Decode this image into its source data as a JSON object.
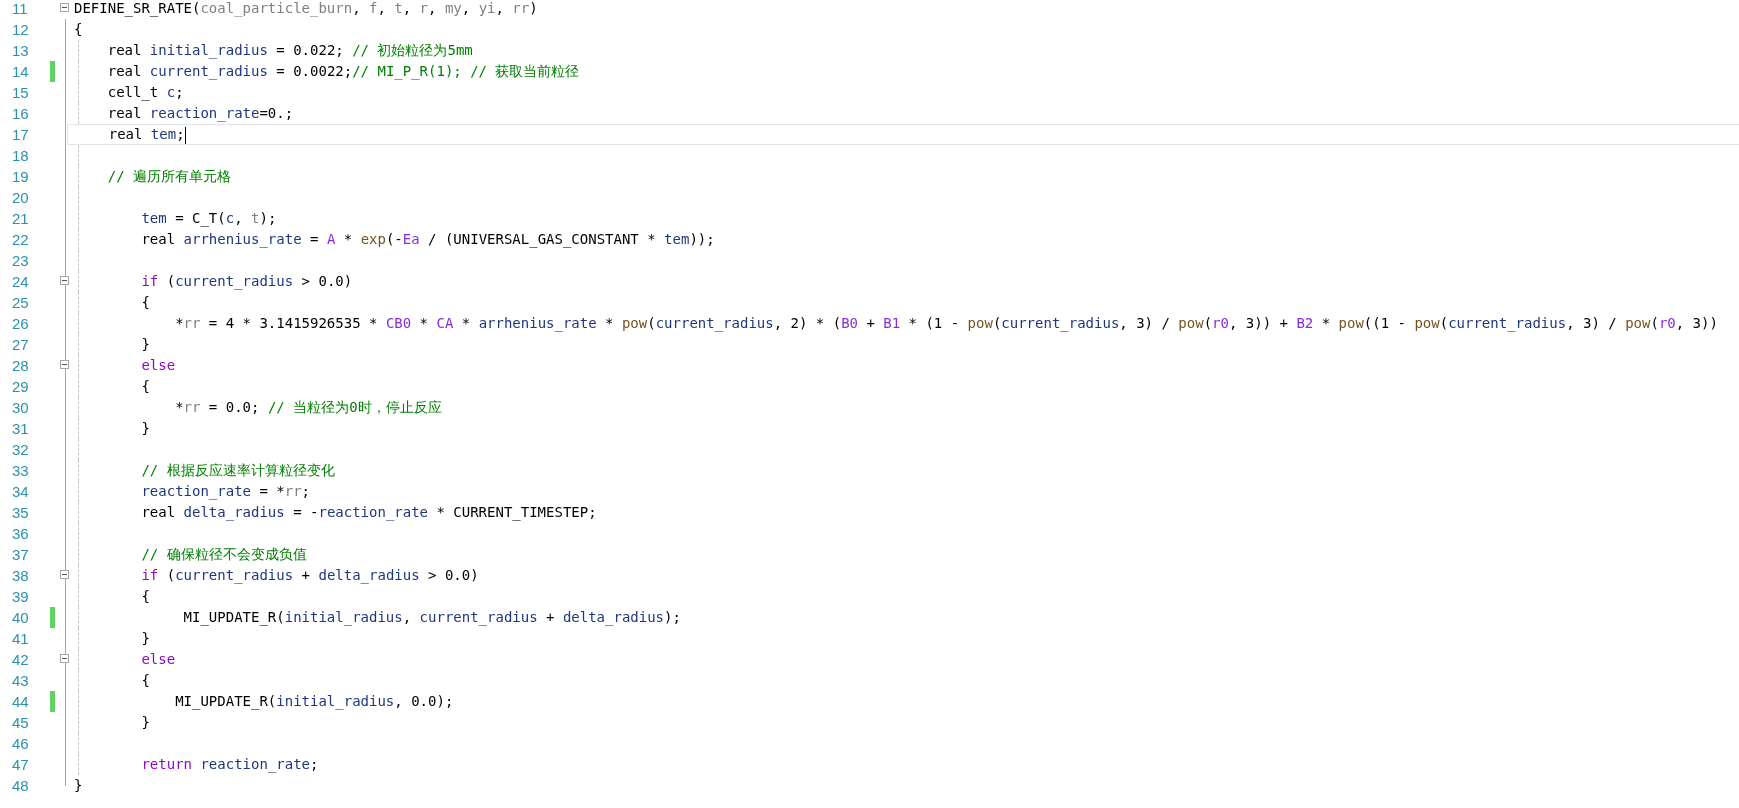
{
  "lines": [
    {
      "number": "11",
      "modified": false,
      "current": false,
      "fold": {
        "expanded": true
      },
      "tokens": [
        {
          "kind": "plain",
          "text": "DEFINE_SR_RATE("
        },
        {
          "kind": "param",
          "text": "coal_particle_burn"
        },
        {
          "kind": "plain",
          "text": ", "
        },
        {
          "kind": "param",
          "text": "f"
        },
        {
          "kind": "plain",
          "text": ", "
        },
        {
          "kind": "param",
          "text": "t"
        },
        {
          "kind": "plain",
          "text": ", "
        },
        {
          "kind": "param",
          "text": "r"
        },
        {
          "kind": "plain",
          "text": ", "
        },
        {
          "kind": "param",
          "text": "my"
        },
        {
          "kind": "plain",
          "text": ", "
        },
        {
          "kind": "param",
          "text": "yi"
        },
        {
          "kind": "plain",
          "text": ", "
        },
        {
          "kind": "param",
          "text": "rr"
        },
        {
          "kind": "plain",
          "text": ")"
        }
      ]
    },
    {
      "number": "12",
      "modified": false,
      "current": false,
      "tokens": [
        {
          "kind": "plain",
          "text": "{"
        }
      ]
    },
    {
      "number": "13",
      "modified": false,
      "current": false,
      "tokens": [
        {
          "kind": "plain",
          "text": "    real "
        },
        {
          "kind": "ident",
          "text": "initial_radius"
        },
        {
          "kind": "plain",
          "text": " = 0.022; "
        },
        {
          "kind": "comment",
          "text": "// 初始粒径为5mm"
        }
      ]
    },
    {
      "number": "14",
      "modified": true,
      "current": false,
      "tokens": [
        {
          "kind": "plain",
          "text": "    real "
        },
        {
          "kind": "ident",
          "text": "current_radius"
        },
        {
          "kind": "plain",
          "text": " = 0.0022;"
        },
        {
          "kind": "comment",
          "text": "// MI_P_R(1); // 获取当前粒径"
        }
      ]
    },
    {
      "number": "15",
      "modified": false,
      "current": false,
      "tokens": [
        {
          "kind": "plain",
          "text": "    cell_t "
        },
        {
          "kind": "ident",
          "text": "c"
        },
        {
          "kind": "plain",
          "text": ";"
        }
      ]
    },
    {
      "number": "16",
      "modified": false,
      "current": false,
      "tokens": [
        {
          "kind": "plain",
          "text": "    real "
        },
        {
          "kind": "ident",
          "text": "reaction_rate"
        },
        {
          "kind": "plain",
          "text": "=0.;"
        }
      ]
    },
    {
      "number": "17",
      "modified": false,
      "current": true,
      "tokens": [
        {
          "kind": "plain",
          "text": "    real "
        },
        {
          "kind": "ident",
          "text": "tem"
        },
        {
          "kind": "plain",
          "text": ";"
        }
      ]
    },
    {
      "number": "18",
      "modified": false,
      "current": false
    },
    {
      "number": "19",
      "modified": false,
      "current": false,
      "tokens": [
        {
          "kind": "comment",
          "text": "    // 遍历所有单元格"
        }
      ]
    },
    {
      "number": "20",
      "modified": false,
      "current": false
    },
    {
      "number": "21",
      "modified": false,
      "current": false,
      "tokens": [
        {
          "kind": "ident",
          "text": "        tem"
        },
        {
          "kind": "plain",
          "text": " = C_T("
        },
        {
          "kind": "ident",
          "text": "c"
        },
        {
          "kind": "plain",
          "text": ", "
        },
        {
          "kind": "param",
          "text": "t"
        },
        {
          "kind": "plain",
          "text": ");"
        }
      ]
    },
    {
      "number": "22",
      "modified": false,
      "current": false,
      "tokens": [
        {
          "kind": "plain",
          "text": "        real "
        },
        {
          "kind": "ident",
          "text": "arrhenius_rate"
        },
        {
          "kind": "plain",
          "text": " = "
        },
        {
          "kind": "macro",
          "text": "A"
        },
        {
          "kind": "plain",
          "text": " * "
        },
        {
          "kind": "func",
          "text": "exp"
        },
        {
          "kind": "plain",
          "text": "(-"
        },
        {
          "kind": "macro",
          "text": "Ea"
        },
        {
          "kind": "plain",
          "text": " / (UNIVERSAL_GAS_CONSTANT * "
        },
        {
          "kind": "ident",
          "text": "tem"
        },
        {
          "kind": "plain",
          "text": "));"
        }
      ]
    },
    {
      "number": "23",
      "modified": false,
      "current": false
    },
    {
      "number": "24",
      "modified": false,
      "current": false,
      "fold": {
        "expanded": true
      },
      "tokens": [
        {
          "kind": "keyword",
          "text": "        if"
        },
        {
          "kind": "plain",
          "text": " ("
        },
        {
          "kind": "ident",
          "text": "current_radius"
        },
        {
          "kind": "plain",
          "text": " > 0.0)"
        }
      ]
    },
    {
      "number": "25",
      "modified": false,
      "current": false,
      "tokens": [
        {
          "kind": "plain",
          "text": "        {"
        }
      ]
    },
    {
      "number": "26",
      "modified": false,
      "current": false,
      "tokens": [
        {
          "kind": "plain",
          "text": "            *"
        },
        {
          "kind": "param",
          "text": "rr"
        },
        {
          "kind": "plain",
          "text": " = 4 * 3.1415926535 * "
        },
        {
          "kind": "macro",
          "text": "CB0"
        },
        {
          "kind": "plain",
          "text": " * "
        },
        {
          "kind": "macro",
          "text": "CA"
        },
        {
          "kind": "plain",
          "text": " * "
        },
        {
          "kind": "ident",
          "text": "arrhenius_rate"
        },
        {
          "kind": "plain",
          "text": " * "
        },
        {
          "kind": "func",
          "text": "pow"
        },
        {
          "kind": "plain",
          "text": "("
        },
        {
          "kind": "ident",
          "text": "current_radius"
        },
        {
          "kind": "plain",
          "text": ", 2) * ("
        },
        {
          "kind": "macro",
          "text": "B0"
        },
        {
          "kind": "plain",
          "text": " + "
        },
        {
          "kind": "macro",
          "text": "B1"
        },
        {
          "kind": "plain",
          "text": " * (1 - "
        },
        {
          "kind": "func",
          "text": "pow"
        },
        {
          "kind": "plain",
          "text": "("
        },
        {
          "kind": "ident",
          "text": "current_radius"
        },
        {
          "kind": "plain",
          "text": ", 3) / "
        },
        {
          "kind": "func",
          "text": "pow"
        },
        {
          "kind": "plain",
          "text": "("
        },
        {
          "kind": "macro",
          "text": "r0"
        },
        {
          "kind": "plain",
          "text": ", 3)) + "
        },
        {
          "kind": "macro",
          "text": "B2"
        },
        {
          "kind": "plain",
          "text": " * "
        },
        {
          "kind": "func",
          "text": "pow"
        },
        {
          "kind": "plain",
          "text": "((1 - "
        },
        {
          "kind": "func",
          "text": "pow"
        },
        {
          "kind": "plain",
          "text": "("
        },
        {
          "kind": "ident",
          "text": "current_radius"
        },
        {
          "kind": "plain",
          "text": ", 3) / "
        },
        {
          "kind": "func",
          "text": "pow"
        },
        {
          "kind": "plain",
          "text": "("
        },
        {
          "kind": "macro",
          "text": "r0"
        },
        {
          "kind": "plain",
          "text": ", 3))"
        }
      ]
    },
    {
      "number": "27",
      "modified": false,
      "current": false,
      "tokens": [
        {
          "kind": "plain",
          "text": "        }"
        }
      ]
    },
    {
      "number": "28",
      "modified": false,
      "current": false,
      "fold": {
        "expanded": true
      },
      "tokens": [
        {
          "kind": "keyword",
          "text": "        else"
        }
      ]
    },
    {
      "number": "29",
      "modified": false,
      "current": false,
      "tokens": [
        {
          "kind": "plain",
          "text": "        {"
        }
      ]
    },
    {
      "number": "30",
      "modified": false,
      "current": false,
      "tokens": [
        {
          "kind": "plain",
          "text": "            *"
        },
        {
          "kind": "param",
          "text": "rr"
        },
        {
          "kind": "plain",
          "text": " = 0.0; "
        },
        {
          "kind": "comment",
          "text": "// 当粒径为0时，停止反应"
        }
      ]
    },
    {
      "number": "31",
      "modified": false,
      "current": false,
      "tokens": [
        {
          "kind": "plain",
          "text": "        }"
        }
      ]
    },
    {
      "number": "32",
      "modified": false,
      "current": false
    },
    {
      "number": "33",
      "modified": false,
      "current": false,
      "tokens": [
        {
          "kind": "comment",
          "text": "        // 根据反应速率计算粒径变化"
        }
      ]
    },
    {
      "number": "34",
      "modified": false,
      "current": false,
      "tokens": [
        {
          "kind": "ident",
          "text": "        reaction_rate"
        },
        {
          "kind": "plain",
          "text": " = *"
        },
        {
          "kind": "param",
          "text": "rr"
        },
        {
          "kind": "plain",
          "text": ";"
        }
      ]
    },
    {
      "number": "35",
      "modified": false,
      "current": false,
      "tokens": [
        {
          "kind": "plain",
          "text": "        real "
        },
        {
          "kind": "ident",
          "text": "delta_radius"
        },
        {
          "kind": "plain",
          "text": " = -"
        },
        {
          "kind": "ident",
          "text": "reaction_rate"
        },
        {
          "kind": "plain",
          "text": " * CURRENT_TIMESTEP;"
        }
      ]
    },
    {
      "number": "36",
      "modified": false,
      "current": false
    },
    {
      "number": "37",
      "modified": false,
      "current": false,
      "tokens": [
        {
          "kind": "comment",
          "text": "        // 确保粒径不会变成负值"
        }
      ]
    },
    {
      "number": "38",
      "modified": false,
      "current": false,
      "fold": {
        "expanded": true
      },
      "tokens": [
        {
          "kind": "keyword",
          "text": "        if"
        },
        {
          "kind": "plain",
          "text": " ("
        },
        {
          "kind": "ident",
          "text": "current_radius"
        },
        {
          "kind": "plain",
          "text": " + "
        },
        {
          "kind": "ident",
          "text": "delta_radius"
        },
        {
          "kind": "plain",
          "text": " > 0.0)"
        }
      ]
    },
    {
      "number": "39",
      "modified": false,
      "current": false,
      "tokens": [
        {
          "kind": "plain",
          "text": "        {"
        }
      ]
    },
    {
      "number": "40",
      "modified": true,
      "current": false,
      "tokens": [
        {
          "kind": "plain",
          "text": "             MI_UPDATE_R("
        },
        {
          "kind": "ident",
          "text": "initial_radius"
        },
        {
          "kind": "plain",
          "text": ", "
        },
        {
          "kind": "ident",
          "text": "current_radius"
        },
        {
          "kind": "plain",
          "text": " + "
        },
        {
          "kind": "ident",
          "text": "delta_radius"
        },
        {
          "kind": "plain",
          "text": ");"
        }
      ]
    },
    {
      "number": "41",
      "modified": false,
      "current": false,
      "tokens": [
        {
          "kind": "plain",
          "text": "        }"
        }
      ]
    },
    {
      "number": "42",
      "modified": false,
      "current": false,
      "fold": {
        "expanded": true
      },
      "tokens": [
        {
          "kind": "keyword",
          "text": "        else"
        }
      ]
    },
    {
      "number": "43",
      "modified": false,
      "current": false,
      "tokens": [
        {
          "kind": "plain",
          "text": "        {"
        }
      ]
    },
    {
      "number": "44",
      "modified": true,
      "current": false,
      "tokens": [
        {
          "kind": "plain",
          "text": "            MI_UPDATE_R("
        },
        {
          "kind": "ident",
          "text": "initial_radius"
        },
        {
          "kind": "plain",
          "text": ", 0.0);"
        }
      ]
    },
    {
      "number": "45",
      "modified": false,
      "current": false,
      "tokens": [
        {
          "kind": "plain",
          "text": "        }"
        }
      ]
    },
    {
      "number": "46",
      "modified": false,
      "current": false
    },
    {
      "number": "47",
      "modified": false,
      "current": false,
      "tokens": [
        {
          "kind": "keyword",
          "text": "        return "
        },
        {
          "kind": "ident",
          "text": "reaction_rate"
        },
        {
          "kind": "plain",
          "text": ";"
        }
      ]
    },
    {
      "number": "48",
      "modified": false,
      "current": false,
      "tokens": [
        {
          "kind": "plain",
          "text": "}"
        }
      ]
    }
  ]
}
